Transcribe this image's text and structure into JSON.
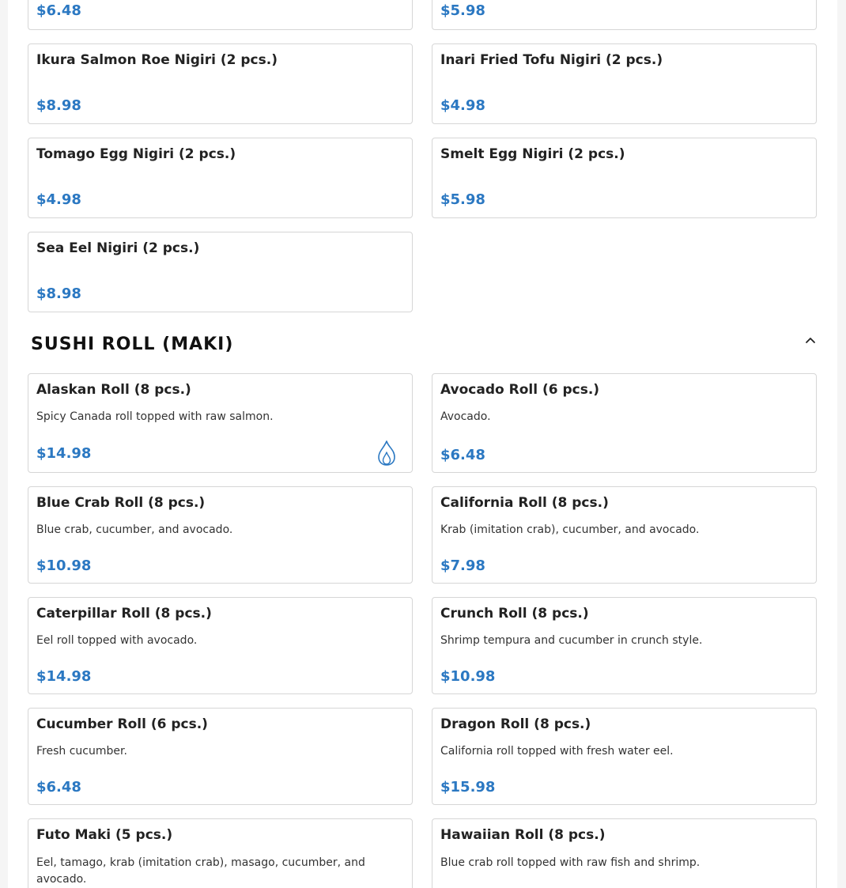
{
  "nigiri_items": [
    {
      "name": "",
      "price": "$6.48"
    },
    {
      "name": "",
      "price": "$5.98"
    },
    {
      "name": "Ikura Salmon Roe Nigiri (2 pcs.)",
      "price": "$8.98"
    },
    {
      "name": "Inari Fried Tofu Nigiri (2 pcs.)",
      "price": "$4.98"
    },
    {
      "name": "Tomago Egg Nigiri (2 pcs.)",
      "price": "$4.98"
    },
    {
      "name": "Smelt Egg Nigiri (2 pcs.)",
      "price": "$5.98"
    },
    {
      "name": "Sea Eel Nigiri (2 pcs.)",
      "price": "$8.98"
    }
  ],
  "sushi_roll_section": {
    "title": "SUSHI ROLL (MAKI)",
    "collapse_icon": "chevron-up-icon",
    "items": [
      {
        "name": "Alaskan Roll (8 pcs.)",
        "description": "Spicy Canada roll topped with raw salmon.",
        "price": "$14.98",
        "spicy_icon": "flame-icon"
      },
      {
        "name": "Avocado Roll (6 pcs.)",
        "description": "Avocado.",
        "price": "$6.48"
      },
      {
        "name": "Blue Crab Roll (8 pcs.)",
        "description": "Blue crab, cucumber, and avocado.",
        "price": "$10.98"
      },
      {
        "name": "California Roll (8 pcs.)",
        "description": "Krab (imitation crab), cucumber, and avocado.",
        "price": "$7.98"
      },
      {
        "name": "Caterpillar Roll (8 pcs.)",
        "description": "Eel roll topped with avocado.",
        "price": "$14.98"
      },
      {
        "name": "Crunch Roll (8 pcs.)",
        "description": "Shrimp tempura and cucumber in crunch style.",
        "price": "$10.98"
      },
      {
        "name": "Cucumber Roll (6 pcs.)",
        "description": "Fresh cucumber.",
        "price": "$6.48"
      },
      {
        "name": "Dragon Roll (8 pcs.)",
        "description": "California roll topped with fresh water eel.",
        "price": "$15.98"
      },
      {
        "name": "Futo Maki (5 pcs.)",
        "description": "Eel, tamago, krab (imitation crab), masago, cucumber, and avocado."
      },
      {
        "name": "Hawaiian Roll (8 pcs.)",
        "description": "Blue crab roll topped with raw fish and shrimp."
      }
    ]
  },
  "colors": {
    "price": "#2b78c2",
    "border": "#d6d6d6",
    "spicy_icon": "#2b78c2"
  }
}
